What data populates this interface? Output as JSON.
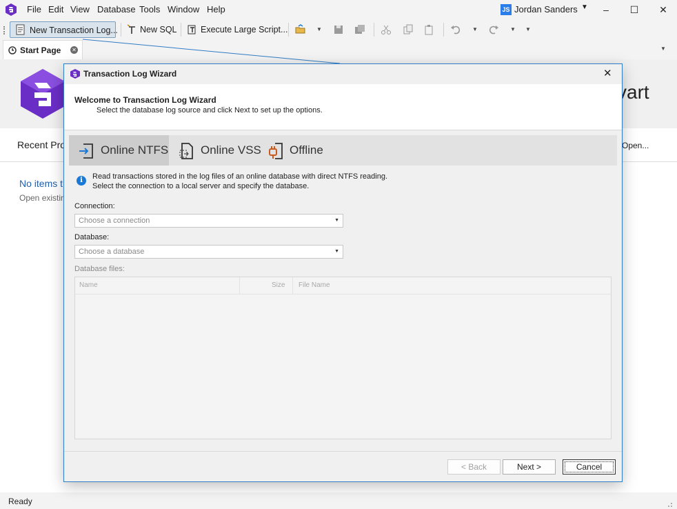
{
  "menu": {
    "items": [
      "File",
      "Edit",
      "View",
      "Database",
      "Tools",
      "Window",
      "Help"
    ],
    "user_initials": "JS",
    "user_name": "Jordan Sanders"
  },
  "toolbar": {
    "new_transaction_log": "New Transaction Log...",
    "new_sql": "New SQL",
    "execute_large_script": "Execute Large Script..."
  },
  "tabs": {
    "start_page": "Start Page"
  },
  "start_page": {
    "brand_fragment": "vart",
    "recent_label": "Recent Pro",
    "open_label": "Open...",
    "no_items": "No items t",
    "open_existing": "Open existin"
  },
  "status": {
    "text": "Ready"
  },
  "dialog": {
    "title": "Transaction Log Wizard",
    "heading": "Welcome to Transaction Log Wizard",
    "subheading": "Select the database log source and click Next to set up the options.",
    "modes": [
      {
        "label": "Online NTFS",
        "active": true
      },
      {
        "label": "Online VSS",
        "active": false
      },
      {
        "label": "Offline",
        "active": false
      }
    ],
    "info_line1": "Read transactions stored in the log files of an online database with direct NTFS reading.",
    "info_line2": "Select the connection to a local server and specify the database.",
    "connection_label": "Connection:",
    "connection_placeholder": "Choose a connection",
    "database_label": "Database:",
    "database_placeholder": "Choose a database",
    "files_label": "Database files:",
    "files_columns": [
      "Name",
      "Size",
      "File Name"
    ],
    "back_label": "< Back",
    "next_label": "Next >",
    "cancel_label": "Cancel"
  },
  "colors": {
    "accent": "#2f7bc4",
    "brand": "#6a2ec7",
    "info": "#1a78d6",
    "link": "#1f5fae"
  }
}
